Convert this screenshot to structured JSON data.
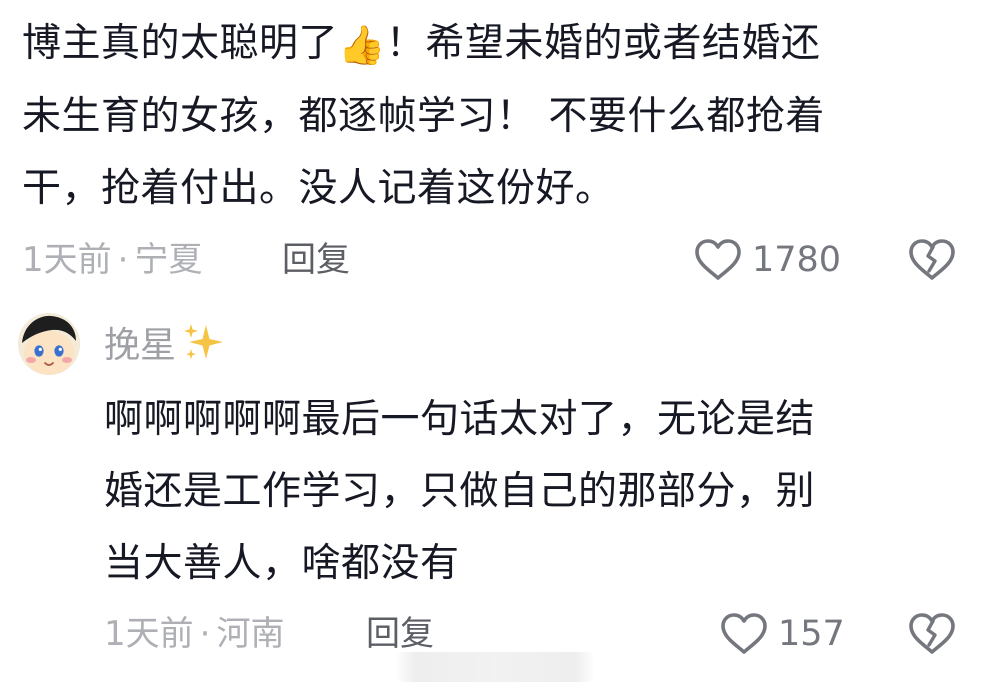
{
  "comments": [
    {
      "text_lines": [
        "博主真的太聪明了",
        "未生育的女孩，都逐帧学习！  不要什么都抢着",
        "干，抢着付出。没人记着这份好。"
      ],
      "text_line1_tail": "！希望未婚的或者结婚还",
      "emoji": "👍",
      "time": "1天前",
      "separator": "·",
      "location": "宁夏",
      "reply_label": "回复",
      "like_count": "1780"
    },
    {
      "username": "挽星",
      "text_lines": [
        "啊啊啊啊啊最后一句话太对了，无论是结",
        "婚还是工作学习，只做自己的那部分，别",
        "当大善人，啥都没有"
      ],
      "time": "1天前",
      "separator": "·",
      "location": "河南",
      "reply_label": "回复",
      "like_count": "157"
    }
  ],
  "icons": {
    "like": "heart-outline-icon",
    "dislike": "broken-heart-icon",
    "sparkle": "sparkles-icon"
  },
  "colors": {
    "text": "#161823",
    "meta": "#aeb0b6",
    "reply": "#5c5e66",
    "icon": "#75777e",
    "sparkle": "#f6c445"
  }
}
